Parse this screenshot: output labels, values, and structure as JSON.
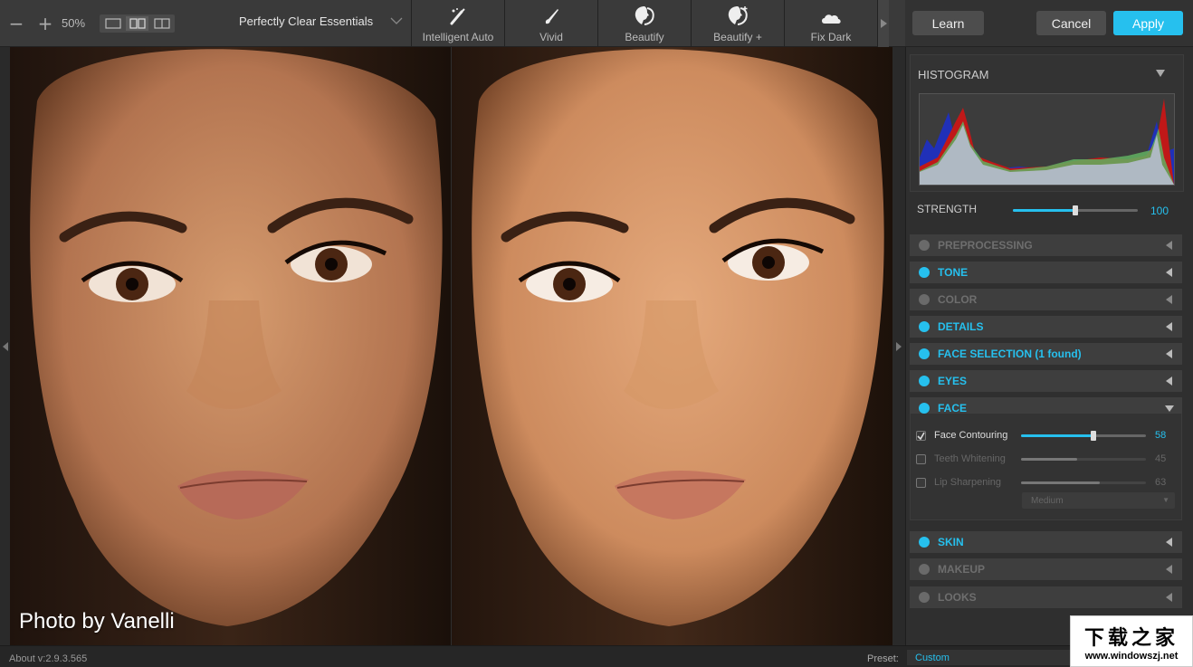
{
  "toolbar": {
    "zoom_out": "−",
    "zoom_in": "+",
    "zoom_level": "50%",
    "preset_group": "Perfectly Clear Essentials",
    "presets": [
      {
        "label": "Intelligent Auto",
        "icon": "brush-sparkle-icon"
      },
      {
        "label": "Vivid",
        "icon": "brush-icon"
      },
      {
        "label": "Beautify",
        "icon": "face-profile-icon"
      },
      {
        "label": "Beautify +",
        "icon": "face-profile-plus-icon"
      },
      {
        "label": "Fix Dark",
        "icon": "cloud-icon"
      }
    ]
  },
  "actions": {
    "learn": "Learn",
    "cancel": "Cancel",
    "apply": "Apply"
  },
  "image": {
    "watermark": "Photo by Vanelli"
  },
  "histogram": {
    "title": "HISTOGRAM"
  },
  "strength": {
    "label": "STRENGTH",
    "value": "100",
    "fraction": 0.5
  },
  "sections": [
    {
      "label": "PREPROCESSING",
      "enabled": false
    },
    {
      "label": "TONE",
      "enabled": true
    },
    {
      "label": "COLOR",
      "enabled": false
    },
    {
      "label": "DETAILS",
      "enabled": true
    },
    {
      "label": "FACE SELECTION (1 found)",
      "enabled": true
    },
    {
      "label": "EYES",
      "enabled": true
    },
    {
      "label": "FACE",
      "enabled": true,
      "expanded": true
    },
    {
      "label": "SKIN",
      "enabled": true
    },
    {
      "label": "MAKEUP",
      "enabled": false
    },
    {
      "label": "LOOKS",
      "enabled": false
    }
  ],
  "face": {
    "controls": [
      {
        "label": "Face Contouring",
        "checked": true,
        "value": "58",
        "fraction": 0.58
      },
      {
        "label": "Teeth Whitening",
        "checked": false,
        "value": "45",
        "fraction": 0.45
      },
      {
        "label": "Lip Sharpening",
        "checked": false,
        "value": "63",
        "fraction": 0.63
      }
    ],
    "mode": "Medium"
  },
  "status": {
    "version": "About v:2.9.3.565",
    "preset_label": "Preset:",
    "preset_value": "Custom"
  },
  "site_logo": {
    "title": "下载之家",
    "url": "www.windowszj.net"
  },
  "colors": {
    "accent": "#26c0ee",
    "panel": "#2f2f2f",
    "section": "#3e3e3e"
  }
}
